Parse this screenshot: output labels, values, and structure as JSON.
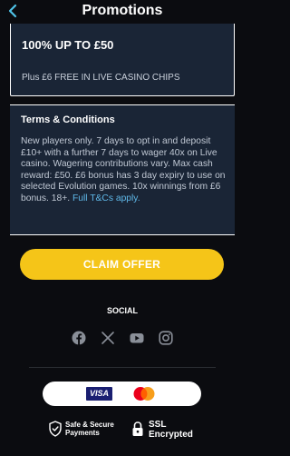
{
  "header": {
    "title": "Promotions",
    "back_icon": "chevron-left-icon"
  },
  "offer": {
    "headline": "100% UP TO £50",
    "subline": "Plus £6 FREE IN LIVE CASINO CHIPS"
  },
  "terms": {
    "title": "Terms & Conditions",
    "body": "New players only. 7 days to opt in and deposit £10+ with a further 7 days to wager 40x on Live casino. Wagering contributions vary. Max cash reward: £50. £6 bonus has 3 day expiry to use on selected Evolution games. 10x winnings from £6 bonus. 18+. ",
    "link": "Full T&Cs apply."
  },
  "cta": {
    "label": "CLAIM OFFER",
    "color": "#f5c518"
  },
  "social": {
    "title": "SOCIAL",
    "icons": [
      "facebook-icon",
      "x-icon",
      "youtube-icon",
      "instagram-icon"
    ]
  },
  "payments": {
    "visa": "VISA",
    "mastercard_icon": "mastercard-icon"
  },
  "badges": {
    "safe_line1": "Safe & Secure",
    "safe_line2": "Payments",
    "ssl_line1": "SSL",
    "ssl_line2": "Encrypted"
  },
  "colors": {
    "background": "#0b0c10",
    "card": "#1a2536",
    "link": "#5fb8e8"
  }
}
